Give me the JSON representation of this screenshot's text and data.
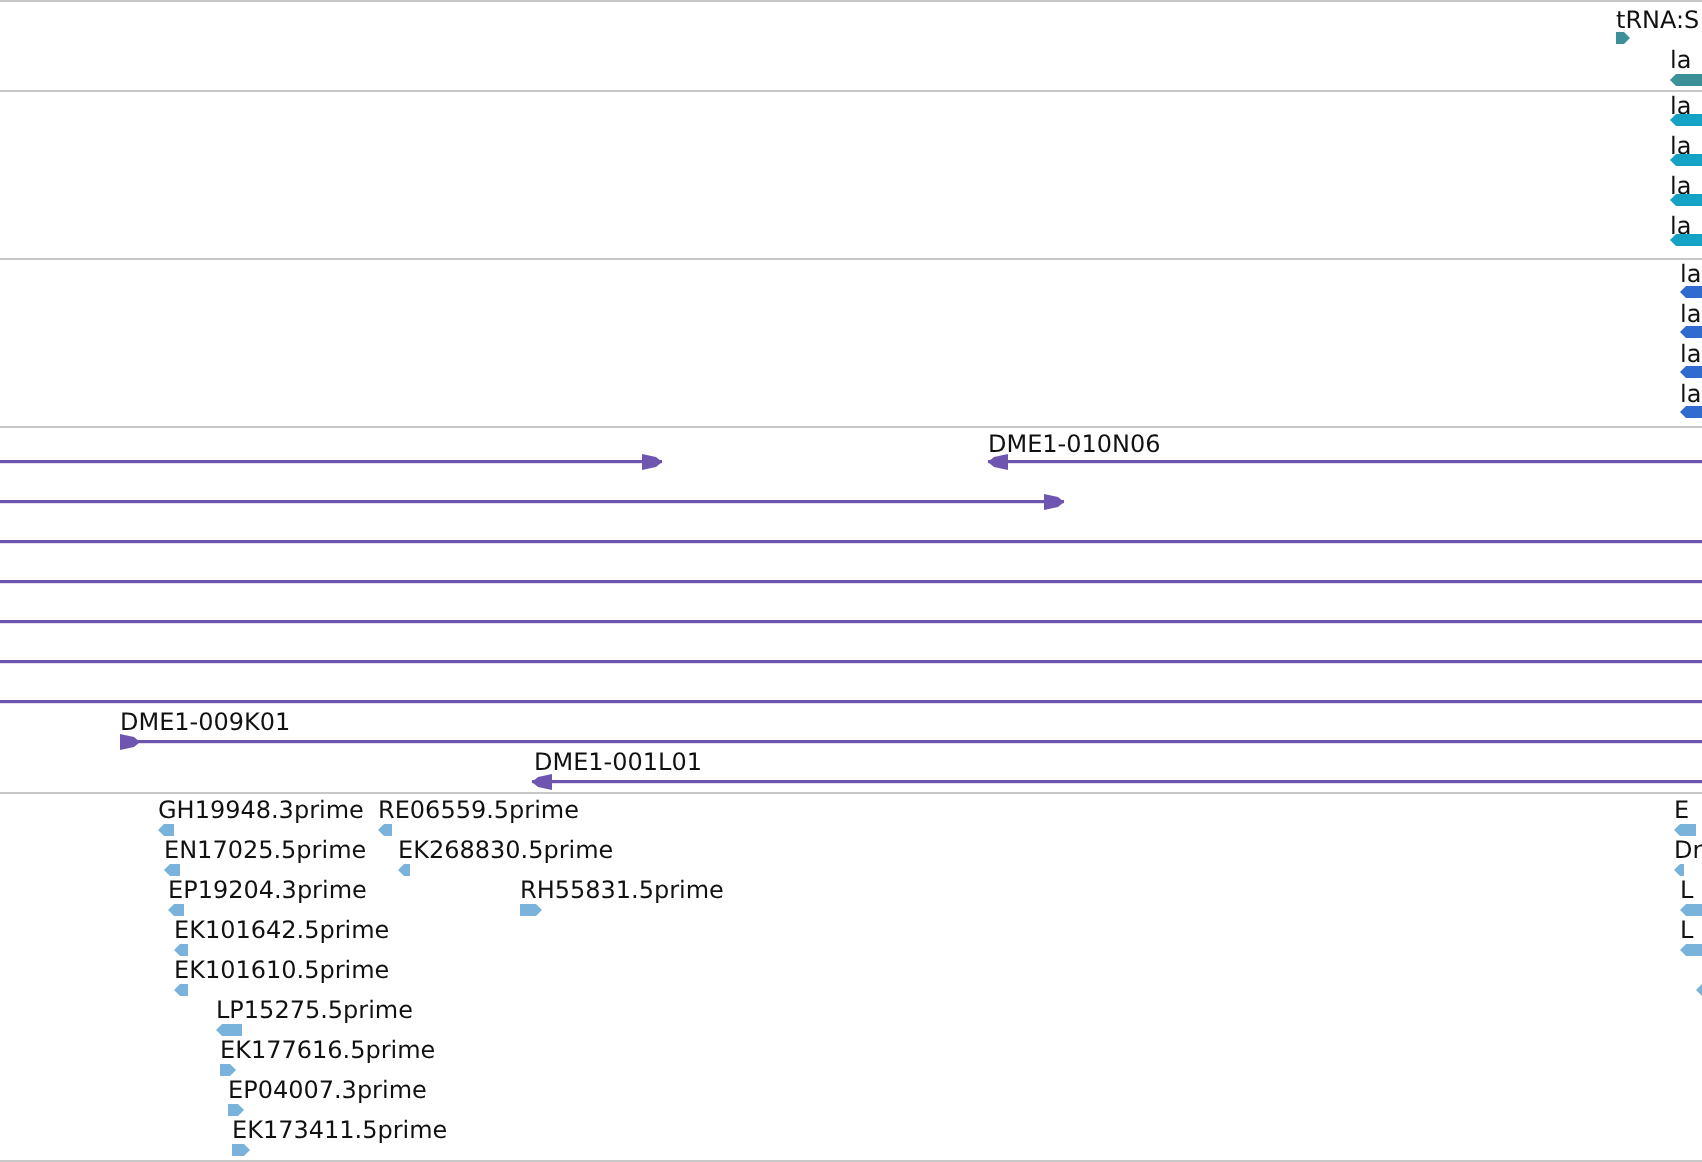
{
  "tracks": [
    {
      "kind": "gene",
      "color": "#3b9099",
      "features": [
        {
          "label": "tRNA:S",
          "reverse": false
        },
        {
          "label": "la",
          "reverse": true
        }
      ]
    },
    {
      "kind": "gene",
      "color": "#14a3c4",
      "features": [
        {
          "label": "la",
          "reverse": true
        },
        {
          "label": "la",
          "reverse": true
        },
        {
          "label": "la",
          "reverse": true
        },
        {
          "label": "la",
          "reverse": true
        }
      ]
    },
    {
      "kind": "gene",
      "color": "#2f6ccd",
      "features": [
        {
          "label": "la",
          "reverse": true
        },
        {
          "label": "la",
          "reverse": true
        },
        {
          "label": "la",
          "reverse": true
        },
        {
          "label": "la",
          "reverse": true
        }
      ]
    },
    {
      "kind": "clone",
      "color": "#6e55b0",
      "features": [
        {
          "kind": "arrow",
          "reverse": false
        },
        {
          "kind": "arrow",
          "label": "DME1-010N06",
          "reverse": true
        },
        {
          "kind": "arrow",
          "reverse": false
        },
        {
          "kind": "clipped"
        },
        {
          "kind": "clipped"
        },
        {
          "kind": "clipped"
        },
        {
          "kind": "clipped"
        },
        {
          "kind": "clipped"
        },
        {
          "kind": "arrow",
          "label": "DME1-009K01",
          "reverse": false
        },
        {
          "kind": "arrow",
          "label": "DME1-001L01",
          "reverse": true
        }
      ]
    },
    {
      "kind": "est",
      "color": "#79b3dc",
      "features": [
        {
          "label": "GH19948.3prime",
          "reverse": true
        },
        {
          "label": "RE06559.5prime",
          "reverse": true
        },
        {
          "label": "EN17025.5prime",
          "reverse": true
        },
        {
          "label": "EK268830.5prime",
          "reverse": true
        },
        {
          "label": "EP19204.3prime",
          "reverse": true
        },
        {
          "label": "RH55831.5prime",
          "reverse": false
        },
        {
          "label": "EK101642.5prime",
          "reverse": true
        },
        {
          "label": "EK101610.5prime",
          "reverse": true
        },
        {
          "label": "LP15275.5prime",
          "reverse": true
        },
        {
          "label": "EK177616.5prime",
          "reverse": false
        },
        {
          "label": "EP04007.3prime",
          "reverse": false
        },
        {
          "label": "EK173411.5prime",
          "reverse": false
        },
        {
          "label": "E",
          "reverse": true
        },
        {
          "label": "Dr",
          "reverse": true
        },
        {
          "label": "L",
          "reverse": true
        },
        {
          "label": "L",
          "reverse": true
        },
        {
          "reverse": true
        }
      ]
    }
  ]
}
